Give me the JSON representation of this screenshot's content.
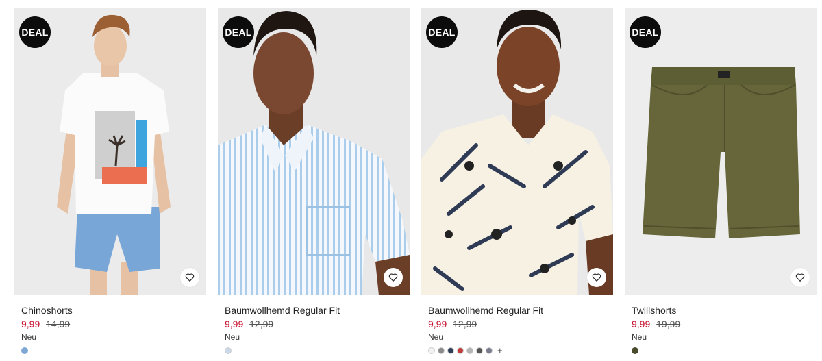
{
  "products": [
    {
      "badge": "DEAL",
      "name": "Chinoshorts",
      "price_now": "9,99",
      "price_old": "14,99",
      "flag": "Neu",
      "swatches": [
        "#7fa7d3"
      ],
      "more_colors": ""
    },
    {
      "badge": "DEAL",
      "name": "Baumwollhemd Regular Fit",
      "price_now": "9,99",
      "price_old": "12,99",
      "flag": "Neu",
      "swatches": [
        "#c9d9ea"
      ],
      "more_colors": ""
    },
    {
      "badge": "DEAL",
      "name": "Baumwollhemd Regular Fit",
      "price_now": "9,99",
      "price_old": "12,99",
      "flag": "Neu",
      "swatches": [
        "#f2f2f2",
        "#8a8a8a",
        "#2d3e55",
        "#c23b3b",
        "#b5b5b5",
        "#555555",
        "#7b7b8f"
      ],
      "more_colors": "+"
    },
    {
      "badge": "DEAL",
      "name": "Twillshorts",
      "price_now": "9,99",
      "price_old": "19,99",
      "flag": "Neu",
      "swatches": [
        "#4a4a2c"
      ],
      "more_colors": ""
    }
  ],
  "icons": {
    "favorite": "heart-outline-icon"
  },
  "colors": {
    "sale_price": "#c8102e",
    "deal_badge": "#0c0c0c"
  }
}
